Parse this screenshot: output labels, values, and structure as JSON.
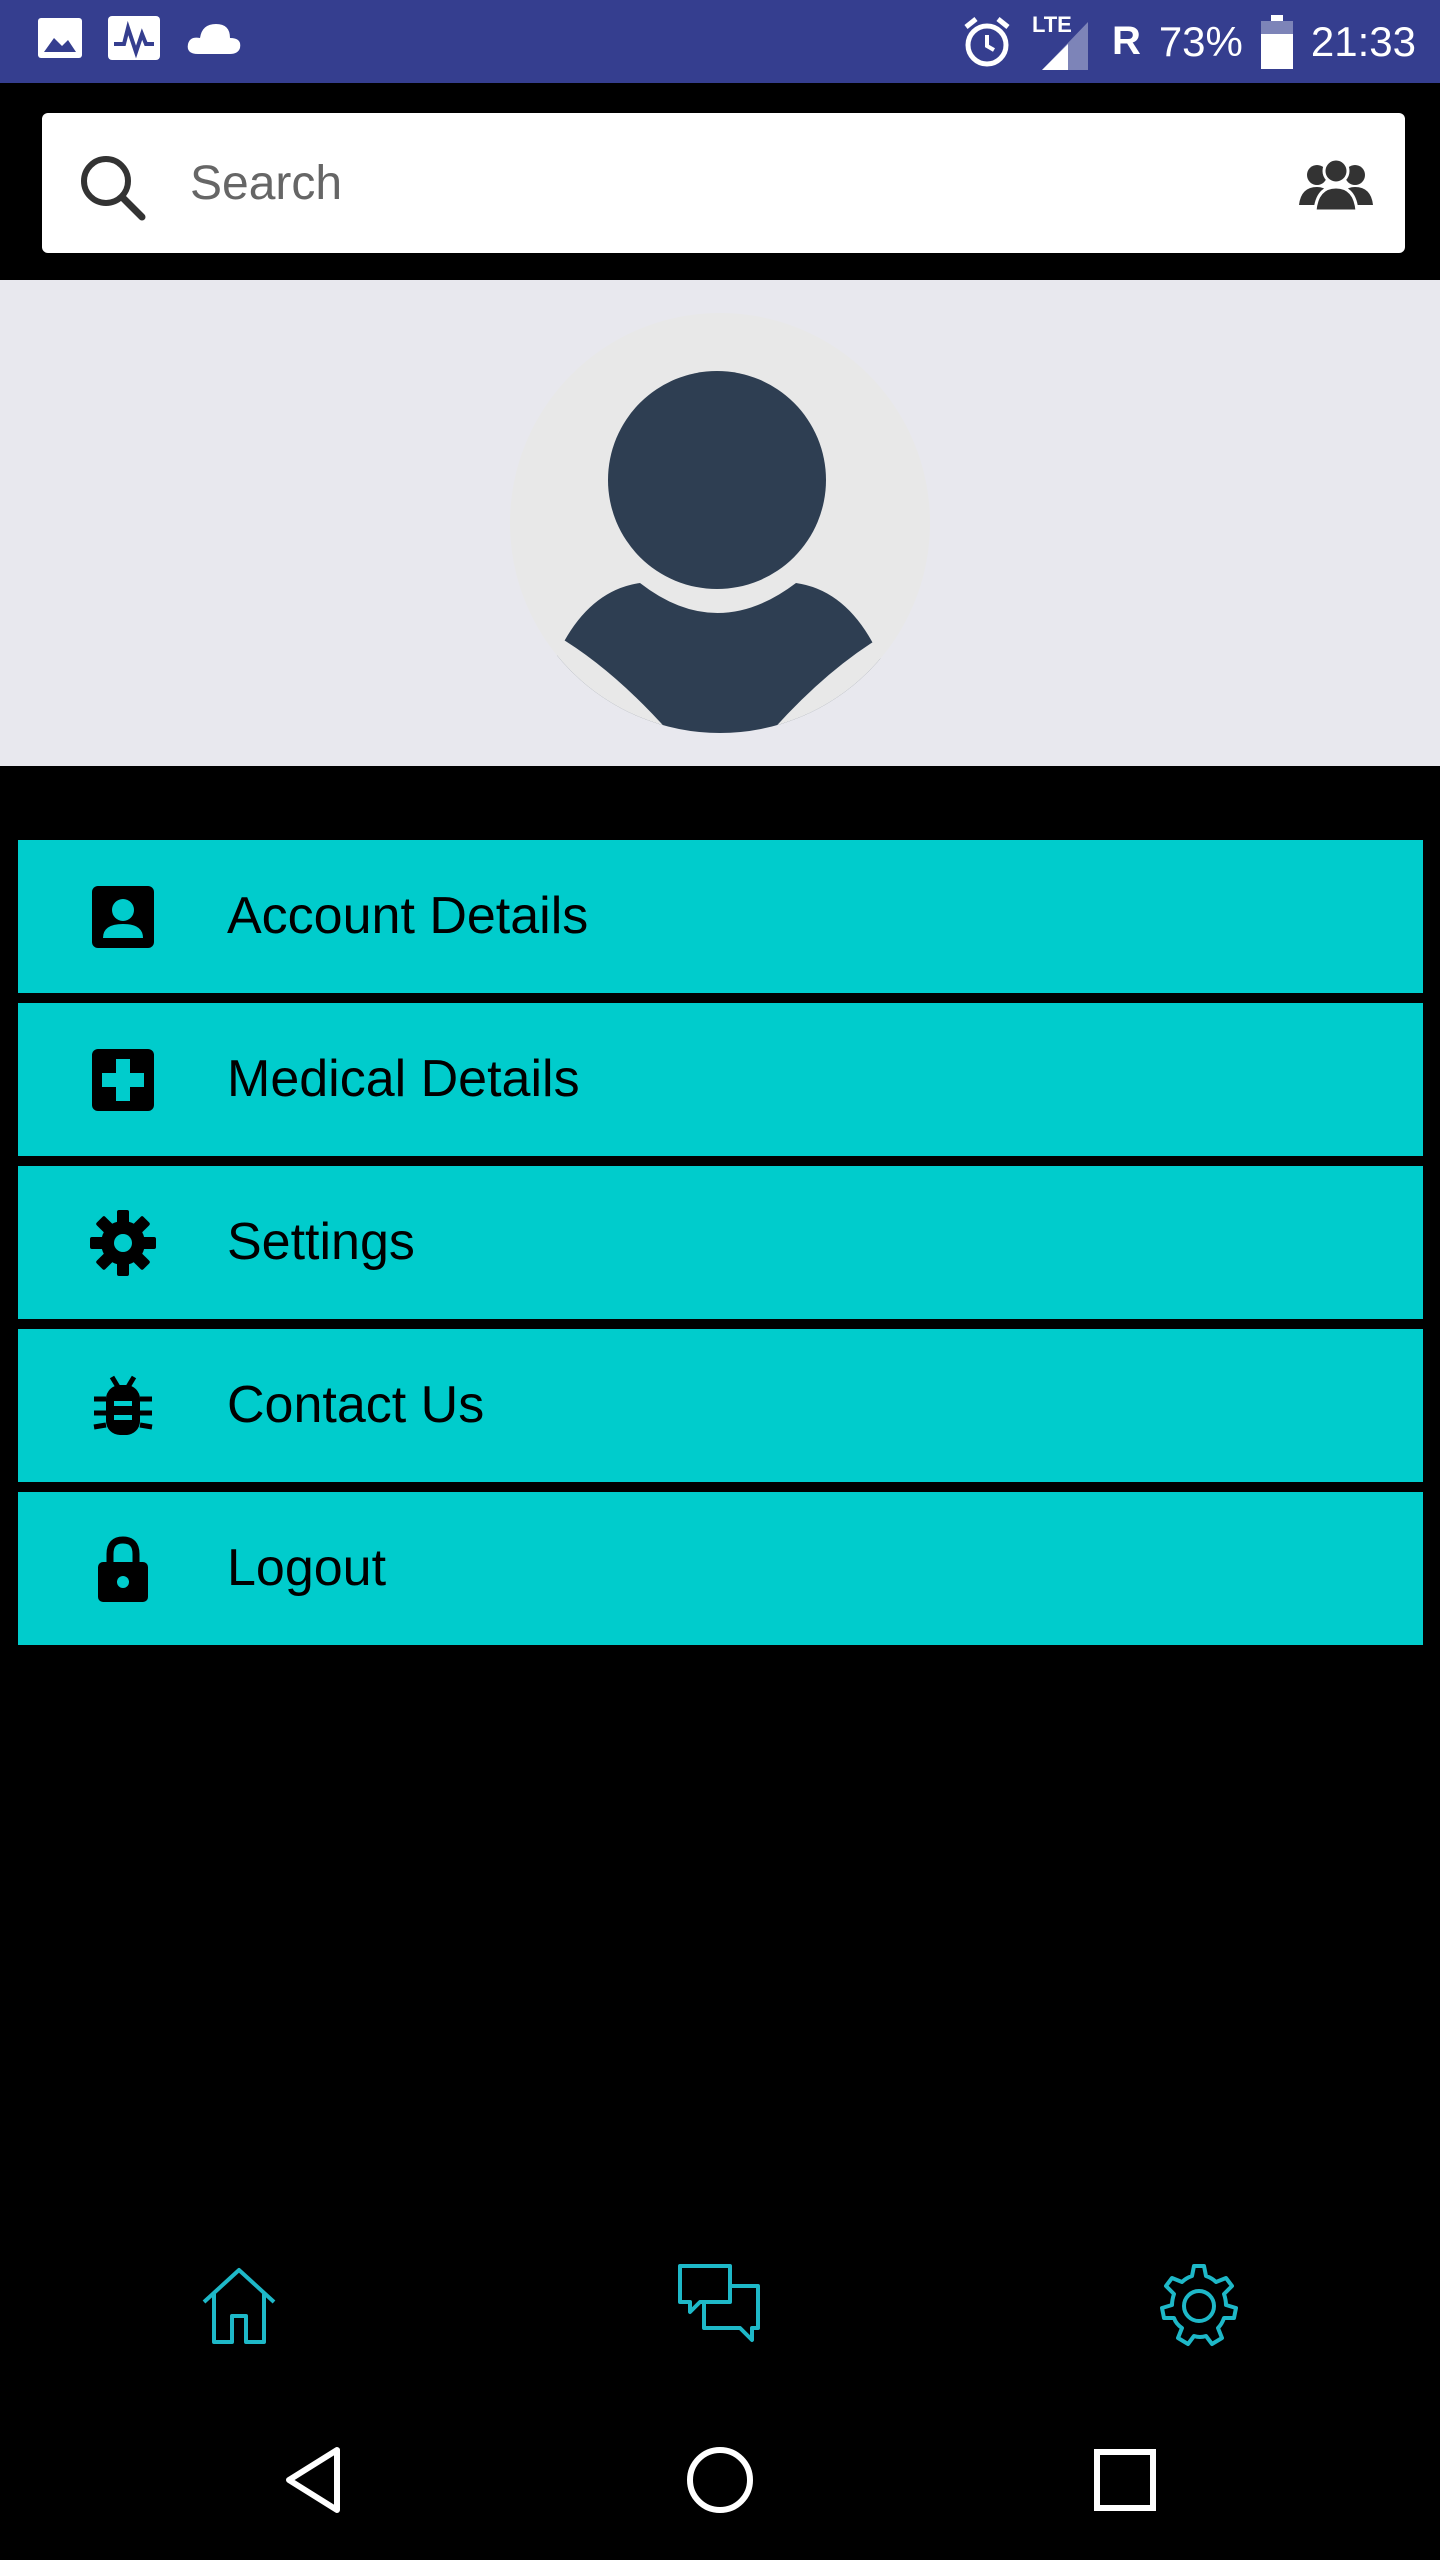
{
  "status_bar": {
    "network_label": "LTE",
    "roaming": "R",
    "battery": "73%",
    "time": "21:33",
    "left_icons": [
      "image-icon",
      "activity-icon",
      "cloud-icon"
    ],
    "right_icons": [
      "alarm-icon",
      "signal-icon",
      "battery-icon"
    ]
  },
  "search": {
    "placeholder": "Search",
    "value": ""
  },
  "profile": {
    "avatar_icon": "user-avatar-icon"
  },
  "menu": {
    "items": [
      {
        "label": "Account Details",
        "icon": "account-box-icon"
      },
      {
        "label": "Medical Details",
        "icon": "medical-cross-icon"
      },
      {
        "label": "Settings",
        "icon": "gear-icon"
      },
      {
        "label": "Contact Us",
        "icon": "bug-icon"
      },
      {
        "label": "Logout",
        "icon": "lock-icon"
      }
    ]
  },
  "bottom_nav": {
    "items": [
      {
        "icon": "home-icon"
      },
      {
        "icon": "chat-icon"
      },
      {
        "icon": "settings-icon"
      }
    ]
  },
  "system_nav": [
    "back-icon",
    "home-circle-icon",
    "recents-icon"
  ],
  "colors": {
    "status_bar": "#353e8f",
    "menu_bg": "#00cccc",
    "accent_icon": "#1eb8c8",
    "profile_bg": "#e8e8ee",
    "avatar_fg": "#2e3e52"
  }
}
